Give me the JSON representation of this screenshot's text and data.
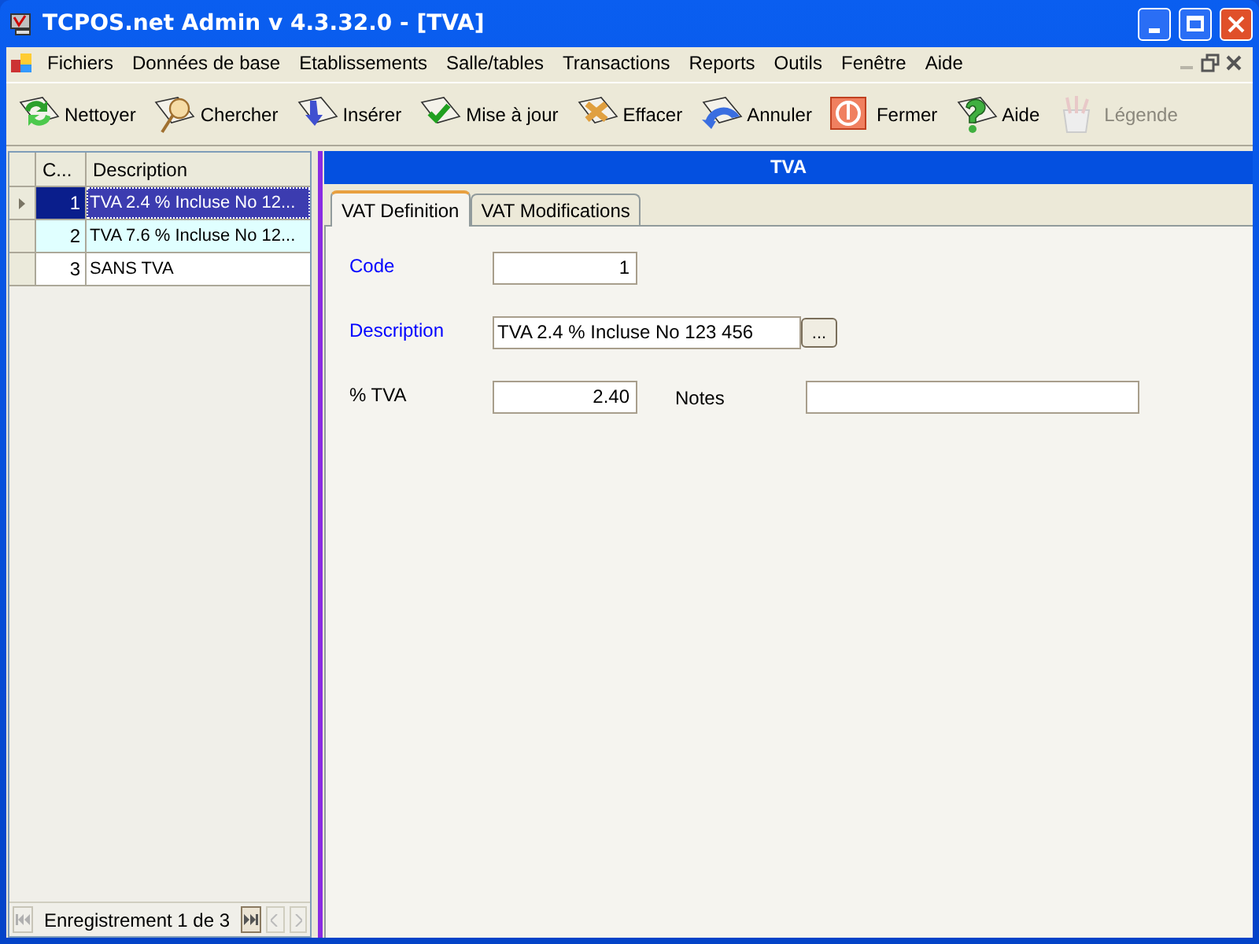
{
  "window": {
    "title": "TCPOS.net Admin v 4.3.32.0 - [TVA]"
  },
  "menu": [
    "Fichiers",
    "Données de base",
    "Etablissements",
    "Salle/tables",
    "Transactions",
    "Reports",
    "Outils",
    "Fenêtre",
    "Aide"
  ],
  "toolbar": [
    {
      "kind": "clear",
      "label": "Nettoyer",
      "disabled": false
    },
    {
      "kind": "search",
      "label": "Chercher",
      "disabled": false
    },
    {
      "kind": "insert",
      "label": "Insérer",
      "disabled": false
    },
    {
      "kind": "update",
      "label": "Mise à jour",
      "disabled": false
    },
    {
      "kind": "delete",
      "label": "Effacer",
      "disabled": false
    },
    {
      "kind": "undo",
      "label": "Annuler",
      "disabled": false
    },
    {
      "kind": "close",
      "label": "Fermer",
      "disabled": false
    },
    {
      "kind": "help",
      "label": "Aide",
      "disabled": false
    },
    {
      "kind": "legend",
      "label": "Légende",
      "disabled": true
    }
  ],
  "grid": {
    "columns": [
      "C...",
      "Description"
    ],
    "rows": [
      {
        "code": "1",
        "description": "TVA 2.4 % Incluse No 12...",
        "selected": true
      },
      {
        "code": "2",
        "description": "TVA 7.6 % Incluse No 12...",
        "selected": false
      },
      {
        "code": "3",
        "description": "SANS TVA",
        "selected": false
      }
    ],
    "navigator": "Enregistrement 1 de 3"
  },
  "panel": {
    "title": "TVA",
    "tabs": [
      {
        "label": "VAT Definition",
        "selected": true
      },
      {
        "label": "VAT Modifications",
        "selected": false
      }
    ],
    "fields": {
      "code": {
        "label": "Code",
        "value": "1"
      },
      "description": {
        "label": "Description",
        "value": "TVA 2.4 % Incluse No 123 456",
        "button": "..."
      },
      "vat": {
        "label": "% TVA",
        "value": "2.40"
      },
      "notes": {
        "label": "Notes"
      }
    }
  }
}
